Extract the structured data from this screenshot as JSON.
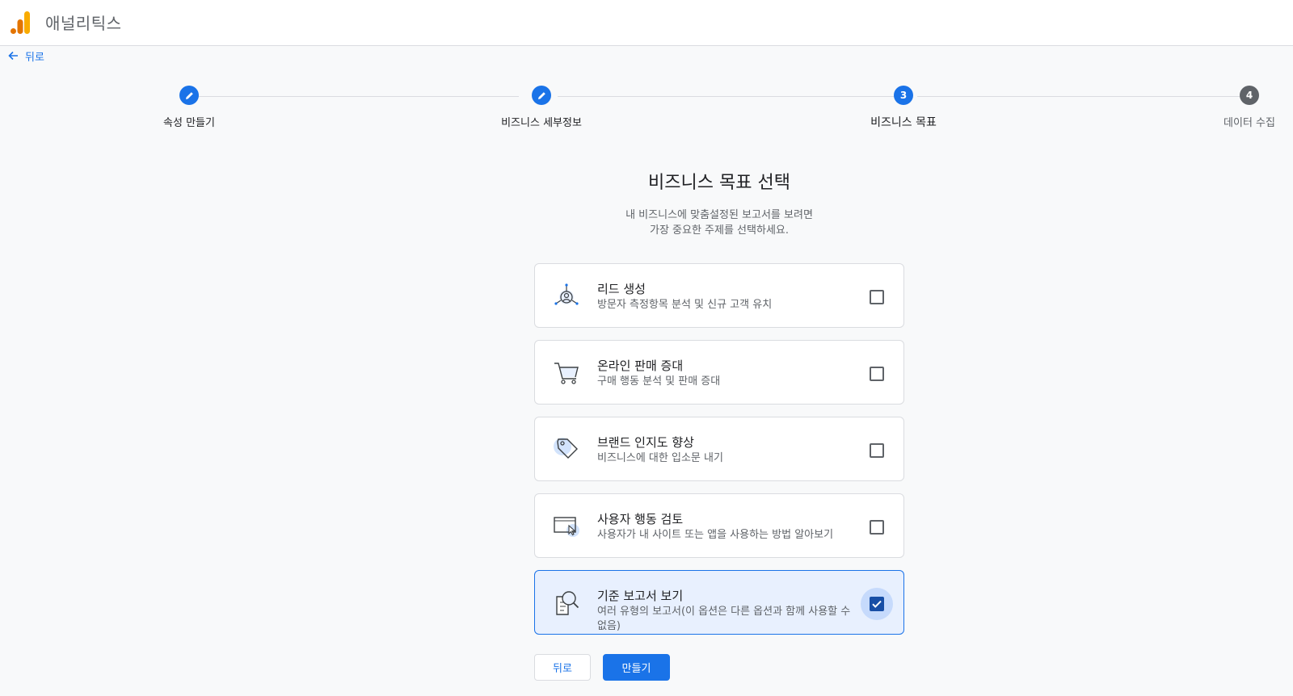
{
  "header": {
    "app_title": "애널리틱스",
    "logo_icon": "analytics-logo-icon"
  },
  "nav": {
    "back_label": "뒤로"
  },
  "stepper": {
    "steps": [
      {
        "label": "속성 만들기",
        "state": "done",
        "icon": "edit-icon"
      },
      {
        "label": "비즈니스 세부정보",
        "state": "done",
        "icon": "edit-icon"
      },
      {
        "label": "비즈니스 목표",
        "state": "active",
        "number": "3"
      },
      {
        "label": "데이터 수집",
        "state": "future",
        "number": "4"
      }
    ]
  },
  "main": {
    "heading": "비즈니스 목표 선택",
    "subtext_line1": "내 비즈니스에 맞춤설정된 보고서를 보려면",
    "subtext_line2": "가장 중요한 주제를 선택하세요."
  },
  "options": [
    {
      "title": "리드 생성",
      "description": "방문자 측정항목 분석 및 신규 고객 유치",
      "icon": "lead-target-icon",
      "checked": false
    },
    {
      "title": "온라인 판매 증대",
      "description": "구매 행동 분석 및 판매 증대",
      "icon": "shopping-cart-icon",
      "checked": false
    },
    {
      "title": "브랜드 인지도 향상",
      "description": "비즈니스에 대한 입소문 내기",
      "icon": "tag-icon",
      "checked": false
    },
    {
      "title": "사용자 행동 검토",
      "description": "사용자가 내 사이트 또는 앱을 사용하는 방법 알아보기",
      "icon": "screen-cursor-icon",
      "checked": false
    },
    {
      "title": "기준 보고서 보기",
      "description": "여러 유형의 보고서(이 옵션은 다른 옵션과 함께 사용할 수 없음)",
      "icon": "report-search-icon",
      "checked": true
    }
  ],
  "footer": {
    "back_button": "뒤로",
    "create_button": "만들기"
  },
  "colors": {
    "accent": "#1a73e8",
    "selected_bg": "#e8f0fe",
    "checkbox_checked": "#174ea6"
  }
}
